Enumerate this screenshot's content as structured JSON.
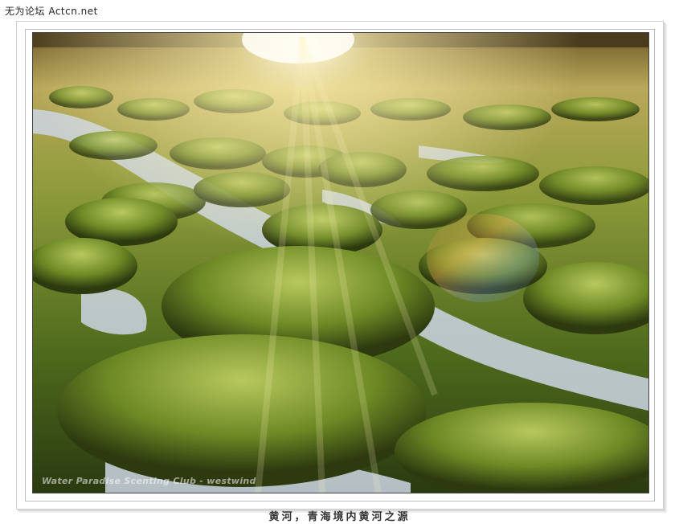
{
  "site_watermark": "无为论坛 Actcn.net",
  "caption": "黄河，青海境内黄河之源",
  "photo_credit": "Water Paradise Scenting Club - westwind",
  "colors": {
    "sky_glow": "#fff6c8",
    "grass_light": "#b9c65a",
    "grass_dark": "#2f3a12",
    "water": "#cfd8e6"
  }
}
